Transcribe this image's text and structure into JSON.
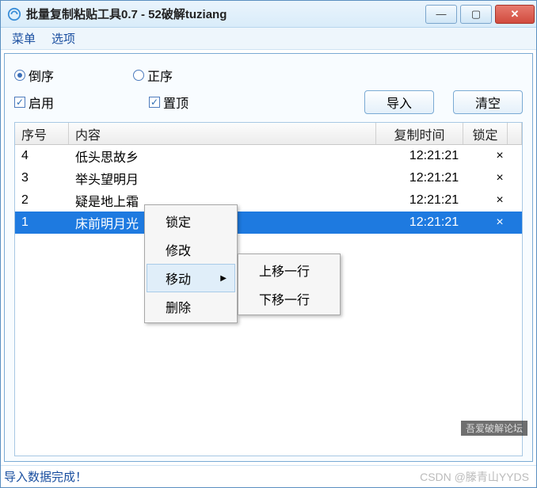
{
  "titlebar": {
    "title": "批量复制粘贴工具0.7 - 52破解tuziang"
  },
  "menubar": {
    "items": [
      "菜单",
      "选项"
    ]
  },
  "options": {
    "order_desc": "倒序",
    "order_asc": "正序",
    "enable": "启用",
    "topmost": "置顶"
  },
  "buttons": {
    "import": "导入",
    "clear": "清空"
  },
  "table": {
    "headers": {
      "num": "序号",
      "content": "内容",
      "time": "复制时间",
      "lock": "锁定"
    },
    "rows": [
      {
        "num": "4",
        "content": "低头思故乡",
        "time": "12:21:21",
        "lock": "×",
        "selected": false
      },
      {
        "num": "3",
        "content": "举头望明月",
        "time": "12:21:21",
        "lock": "×",
        "selected": false
      },
      {
        "num": "2",
        "content": "疑是地上霜",
        "time": "12:21:21",
        "lock": "×",
        "selected": false
      },
      {
        "num": "1",
        "content": "床前明月光",
        "time": "12:21:21",
        "lock": "×",
        "selected": true
      }
    ]
  },
  "context_menu": {
    "items": [
      "锁定",
      "修改",
      "移动",
      "删除"
    ],
    "submenu": [
      "上移一行",
      "下移一行"
    ]
  },
  "status": "导入数据完成！",
  "corner_tag": "吾爱破解论坛",
  "watermark": "CSDN @滕青山YYDS"
}
